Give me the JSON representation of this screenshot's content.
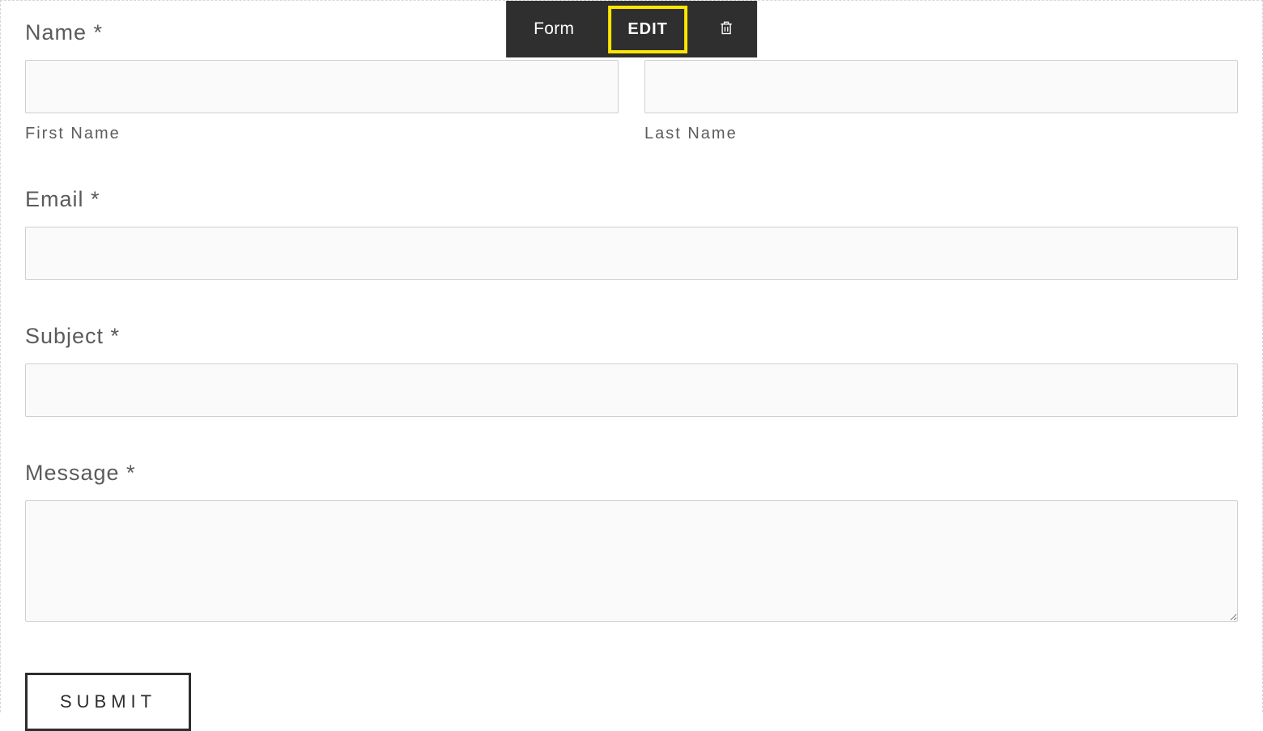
{
  "toolbar": {
    "module_label": "Form",
    "edit_label": "EDIT"
  },
  "form": {
    "name": {
      "label": "Name *",
      "first_sublabel": "First Name",
      "last_sublabel": "Last Name"
    },
    "email": {
      "label": "Email *"
    },
    "subject": {
      "label": "Subject *"
    },
    "message": {
      "label": "Message *"
    },
    "submit_label": "SUBMIT"
  }
}
